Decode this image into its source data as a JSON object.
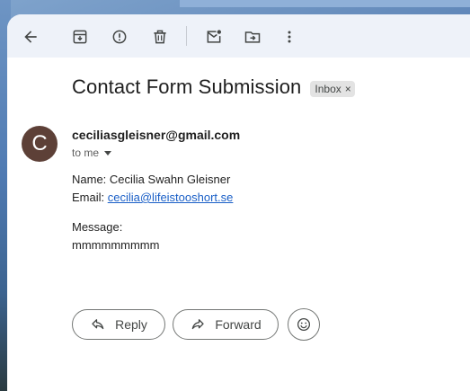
{
  "toolbar": {
    "icons": [
      "back-arrow-icon",
      "archive-icon",
      "report-spam-icon",
      "delete-icon",
      "mark-unread-icon",
      "move-to-icon",
      "more-options-icon"
    ]
  },
  "email": {
    "subject": "Contact Form Submission",
    "label": "Inbox",
    "label_close": "×",
    "avatar_letter": "C",
    "avatar_color": "#5d4037",
    "sender": "ceciliasgleisner@gmail.com",
    "recipient": "to me",
    "body": {
      "name_line": "Name: Cecilia Swahn Gleisner",
      "email_prefix": "Email: ",
      "email_link": "cecilia@lifeistooshort.se",
      "message_label": "Message:",
      "message_text": "mmmmmmmmm"
    }
  },
  "actions": {
    "reply_label": "Reply",
    "forward_label": "Forward"
  },
  "colors": {
    "toolbar_bg": "#eef2f9",
    "link": "#1a5fc7"
  }
}
